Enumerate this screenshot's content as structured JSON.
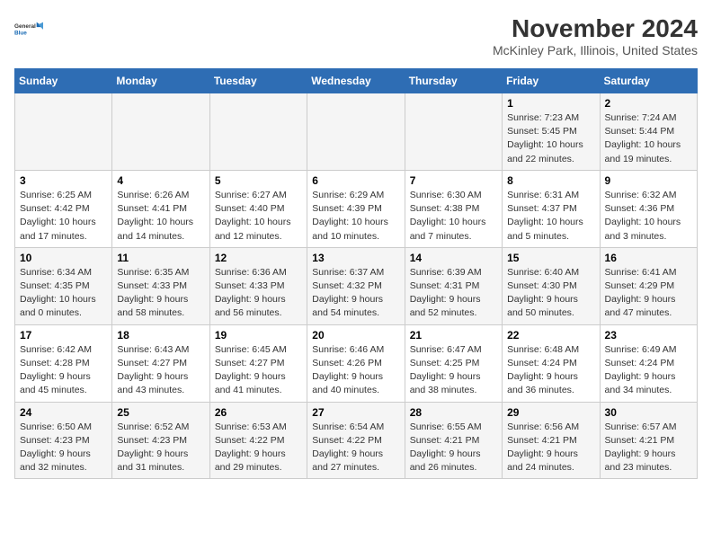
{
  "header": {
    "logo_line1": "General",
    "logo_line2": "Blue",
    "title": "November 2024",
    "subtitle": "McKinley Park, Illinois, United States"
  },
  "calendar": {
    "days_of_week": [
      "Sunday",
      "Monday",
      "Tuesday",
      "Wednesday",
      "Thursday",
      "Friday",
      "Saturday"
    ],
    "weeks": [
      [
        {
          "day": "",
          "info": ""
        },
        {
          "day": "",
          "info": ""
        },
        {
          "day": "",
          "info": ""
        },
        {
          "day": "",
          "info": ""
        },
        {
          "day": "",
          "info": ""
        },
        {
          "day": "1",
          "info": "Sunrise: 7:23 AM\nSunset: 5:45 PM\nDaylight: 10 hours and 22 minutes."
        },
        {
          "day": "2",
          "info": "Sunrise: 7:24 AM\nSunset: 5:44 PM\nDaylight: 10 hours and 19 minutes."
        }
      ],
      [
        {
          "day": "3",
          "info": "Sunrise: 6:25 AM\nSunset: 4:42 PM\nDaylight: 10 hours and 17 minutes."
        },
        {
          "day": "4",
          "info": "Sunrise: 6:26 AM\nSunset: 4:41 PM\nDaylight: 10 hours and 14 minutes."
        },
        {
          "day": "5",
          "info": "Sunrise: 6:27 AM\nSunset: 4:40 PM\nDaylight: 10 hours and 12 minutes."
        },
        {
          "day": "6",
          "info": "Sunrise: 6:29 AM\nSunset: 4:39 PM\nDaylight: 10 hours and 10 minutes."
        },
        {
          "day": "7",
          "info": "Sunrise: 6:30 AM\nSunset: 4:38 PM\nDaylight: 10 hours and 7 minutes."
        },
        {
          "day": "8",
          "info": "Sunrise: 6:31 AM\nSunset: 4:37 PM\nDaylight: 10 hours and 5 minutes."
        },
        {
          "day": "9",
          "info": "Sunrise: 6:32 AM\nSunset: 4:36 PM\nDaylight: 10 hours and 3 minutes."
        }
      ],
      [
        {
          "day": "10",
          "info": "Sunrise: 6:34 AM\nSunset: 4:35 PM\nDaylight: 10 hours and 0 minutes."
        },
        {
          "day": "11",
          "info": "Sunrise: 6:35 AM\nSunset: 4:33 PM\nDaylight: 9 hours and 58 minutes."
        },
        {
          "day": "12",
          "info": "Sunrise: 6:36 AM\nSunset: 4:33 PM\nDaylight: 9 hours and 56 minutes."
        },
        {
          "day": "13",
          "info": "Sunrise: 6:37 AM\nSunset: 4:32 PM\nDaylight: 9 hours and 54 minutes."
        },
        {
          "day": "14",
          "info": "Sunrise: 6:39 AM\nSunset: 4:31 PM\nDaylight: 9 hours and 52 minutes."
        },
        {
          "day": "15",
          "info": "Sunrise: 6:40 AM\nSunset: 4:30 PM\nDaylight: 9 hours and 50 minutes."
        },
        {
          "day": "16",
          "info": "Sunrise: 6:41 AM\nSunset: 4:29 PM\nDaylight: 9 hours and 47 minutes."
        }
      ],
      [
        {
          "day": "17",
          "info": "Sunrise: 6:42 AM\nSunset: 4:28 PM\nDaylight: 9 hours and 45 minutes."
        },
        {
          "day": "18",
          "info": "Sunrise: 6:43 AM\nSunset: 4:27 PM\nDaylight: 9 hours and 43 minutes."
        },
        {
          "day": "19",
          "info": "Sunrise: 6:45 AM\nSunset: 4:27 PM\nDaylight: 9 hours and 41 minutes."
        },
        {
          "day": "20",
          "info": "Sunrise: 6:46 AM\nSunset: 4:26 PM\nDaylight: 9 hours and 40 minutes."
        },
        {
          "day": "21",
          "info": "Sunrise: 6:47 AM\nSunset: 4:25 PM\nDaylight: 9 hours and 38 minutes."
        },
        {
          "day": "22",
          "info": "Sunrise: 6:48 AM\nSunset: 4:24 PM\nDaylight: 9 hours and 36 minutes."
        },
        {
          "day": "23",
          "info": "Sunrise: 6:49 AM\nSunset: 4:24 PM\nDaylight: 9 hours and 34 minutes."
        }
      ],
      [
        {
          "day": "24",
          "info": "Sunrise: 6:50 AM\nSunset: 4:23 PM\nDaylight: 9 hours and 32 minutes."
        },
        {
          "day": "25",
          "info": "Sunrise: 6:52 AM\nSunset: 4:23 PM\nDaylight: 9 hours and 31 minutes."
        },
        {
          "day": "26",
          "info": "Sunrise: 6:53 AM\nSunset: 4:22 PM\nDaylight: 9 hours and 29 minutes."
        },
        {
          "day": "27",
          "info": "Sunrise: 6:54 AM\nSunset: 4:22 PM\nDaylight: 9 hours and 27 minutes."
        },
        {
          "day": "28",
          "info": "Sunrise: 6:55 AM\nSunset: 4:21 PM\nDaylight: 9 hours and 26 minutes."
        },
        {
          "day": "29",
          "info": "Sunrise: 6:56 AM\nSunset: 4:21 PM\nDaylight: 9 hours and 24 minutes."
        },
        {
          "day": "30",
          "info": "Sunrise: 6:57 AM\nSunset: 4:21 PM\nDaylight: 9 hours and 23 minutes."
        }
      ]
    ]
  }
}
